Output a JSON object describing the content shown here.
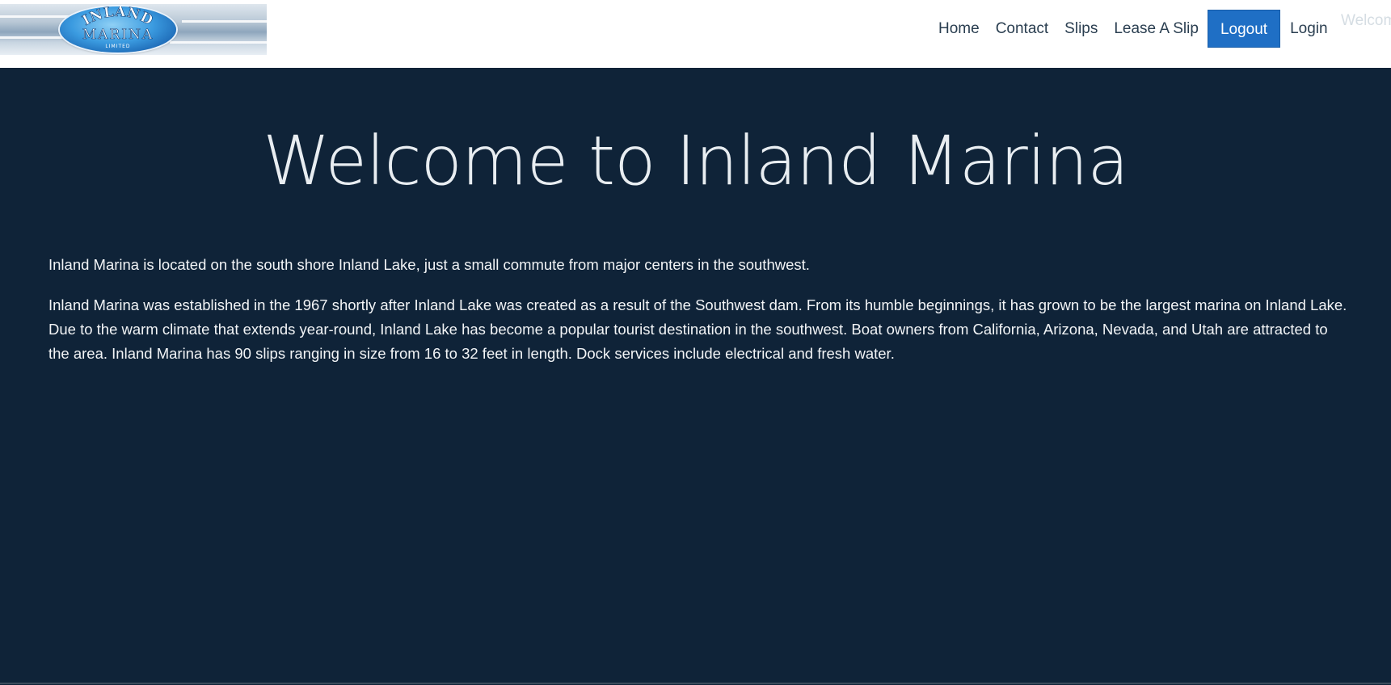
{
  "site": {
    "logo_top": "INLAND",
    "logo_middle": "MARINA",
    "logo_bottom": "LIMITED"
  },
  "nav": {
    "home": "Home",
    "contact": "Contact",
    "slips": "Slips",
    "lease": "Lease A Slip",
    "logout": "Logout",
    "login": "Login",
    "welcome": "Welcome"
  },
  "hero": {
    "title": "Welcome to Inland Marina"
  },
  "content": {
    "paragraph1": "Inland Marina is located on the south shore Inland Lake, just a small commute from major centers in the southwest.",
    "paragraph2": "Inland Marina was established in the 1967 shortly after Inland Lake was created as a result of the Southwest dam. From its humble beginnings, it has grown to be the largest marina on Inland Lake. Due to the warm climate that extends year-round, Inland Lake has become a popular tourist destination in the southwest. Boat owners from California, Arizona, Nevada, and Utah are attracted to the area. Inland Marina has 90 slips ranging in size from 16 to 32 feet in length. Dock services include electrical and fresh water."
  },
  "colors": {
    "background": "#0f2338",
    "navbar": "#ffffff",
    "logout_button": "#1f6fc5",
    "nav_text": "#2a3e50"
  }
}
